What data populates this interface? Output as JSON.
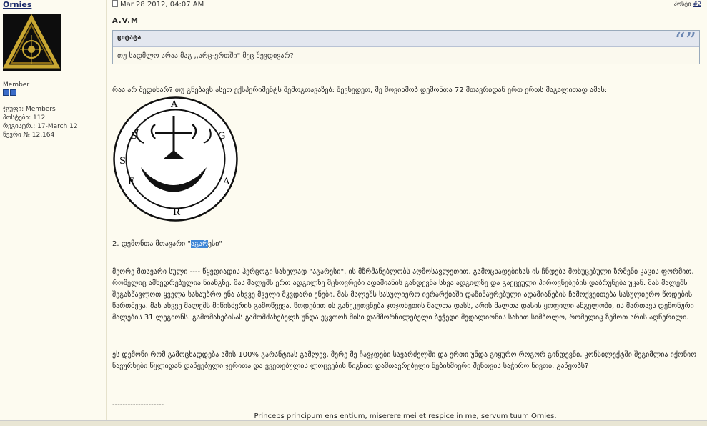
{
  "author": {
    "username": "Ornies",
    "rank": "Member",
    "group_label": "ჯგუფი: Members",
    "posts_label": "პოსტები: 112",
    "joined_label": "რეგისტრ.: 17-March 12",
    "member_no_label": "წევრი № 12,164"
  },
  "post": {
    "date": "Mar 28 2012, 04:07 AM",
    "post_label": "პოსტი",
    "post_number": "#2",
    "title": "A.V.M",
    "quote": {
      "label": "ციტატა",
      "mark": "“”",
      "text": "თუ სადმლო არაა მაგ ,,არც-ერთში\" მეც შევდივარ?"
    },
    "intro": "რაა არ შედიხარ? თუ გნებავს ასეთ ექსპერიმენტს შემოგთავაზებ: შევხედეთ, მე მოვიხმობ დემონთა 72 მთავრიდან ერთ ერთს მაგალითად ამას:",
    "sigil_letters": [
      "S",
      "A",
      "G",
      "A",
      "R",
      "E",
      "S"
    ],
    "heading_prefix": "2. დემონთა მთავარი \"",
    "heading_highlight": "აგარ",
    "heading_suffix": "ესი\"",
    "para1": "მეორე მთავარი სული ---- წყვდიადის ჰერცოგი სახელად \"აგარესი\". ის მზრმანებლობს აღმოსავლეთით. გამოცხადებისას ის ჩნდება მოხუცებული ზრმენი კაცის ფორმით, რომელიც ამხედრებულია ნიანგზე. მას მალეშს ერთ ადგილზე მცხოვრები ადამიანის განდევნა სხვა ადგილზე და გაქცეული პიროვნებების დაბრუნება უკან. მას მალეშს შეგასწავლოთ ყველა სახაუბრო ენა ახვვე მველი მკვდარი ენები. მას მალეშს სასულიერო იერარქიაში დაწინაურებული ადამიანების ჩამოქვეითება სასულიერო წოდების წართმევა. მას ახვვე მალეშს მიწისძვრის გამოწვევა. წოდებით ის განეკუთვნება ჯოჯოხეთის მალთა დასს, არის მალთა დასის ყოფილი ანგელოზი, ის მართავს დემონური მალების 31 ლეგიონს. გამომახებისას გამომძახებელს უნდა ეცვთოს მისი დამმორჩილებელი ბეჭედი მედალიონის სახით სიმბოლო, რომელიც ზემოთ არის აღწერილი.",
    "para2": "ეს დემონი რომ გამოცხადდება ამის 100% გარანტიას გამლევ, მერე მე ჩავჯდები სავარძელში და ერთი უნდა გიყურო როგორ გინდევნი, კონსილექტში შეგიმლია იქონიო ნავურხები წყლიდან დაწყებული ჯერითა და ვვეთებულის ლოცვების წიგნით დამთავრებული ნებისმიერი შენთვის საჭირო ნივთი. გაწყობს?",
    "signature_dash": "--------------------",
    "signature": "Princeps principum ens entium, miserere mei et respice in me, servum tuum Ornies."
  },
  "colors": {
    "background": "#fdfbf0",
    "link": "#1a2a6a",
    "highlight": "#3f86d6",
    "quote_header": "#e3e7ef"
  }
}
